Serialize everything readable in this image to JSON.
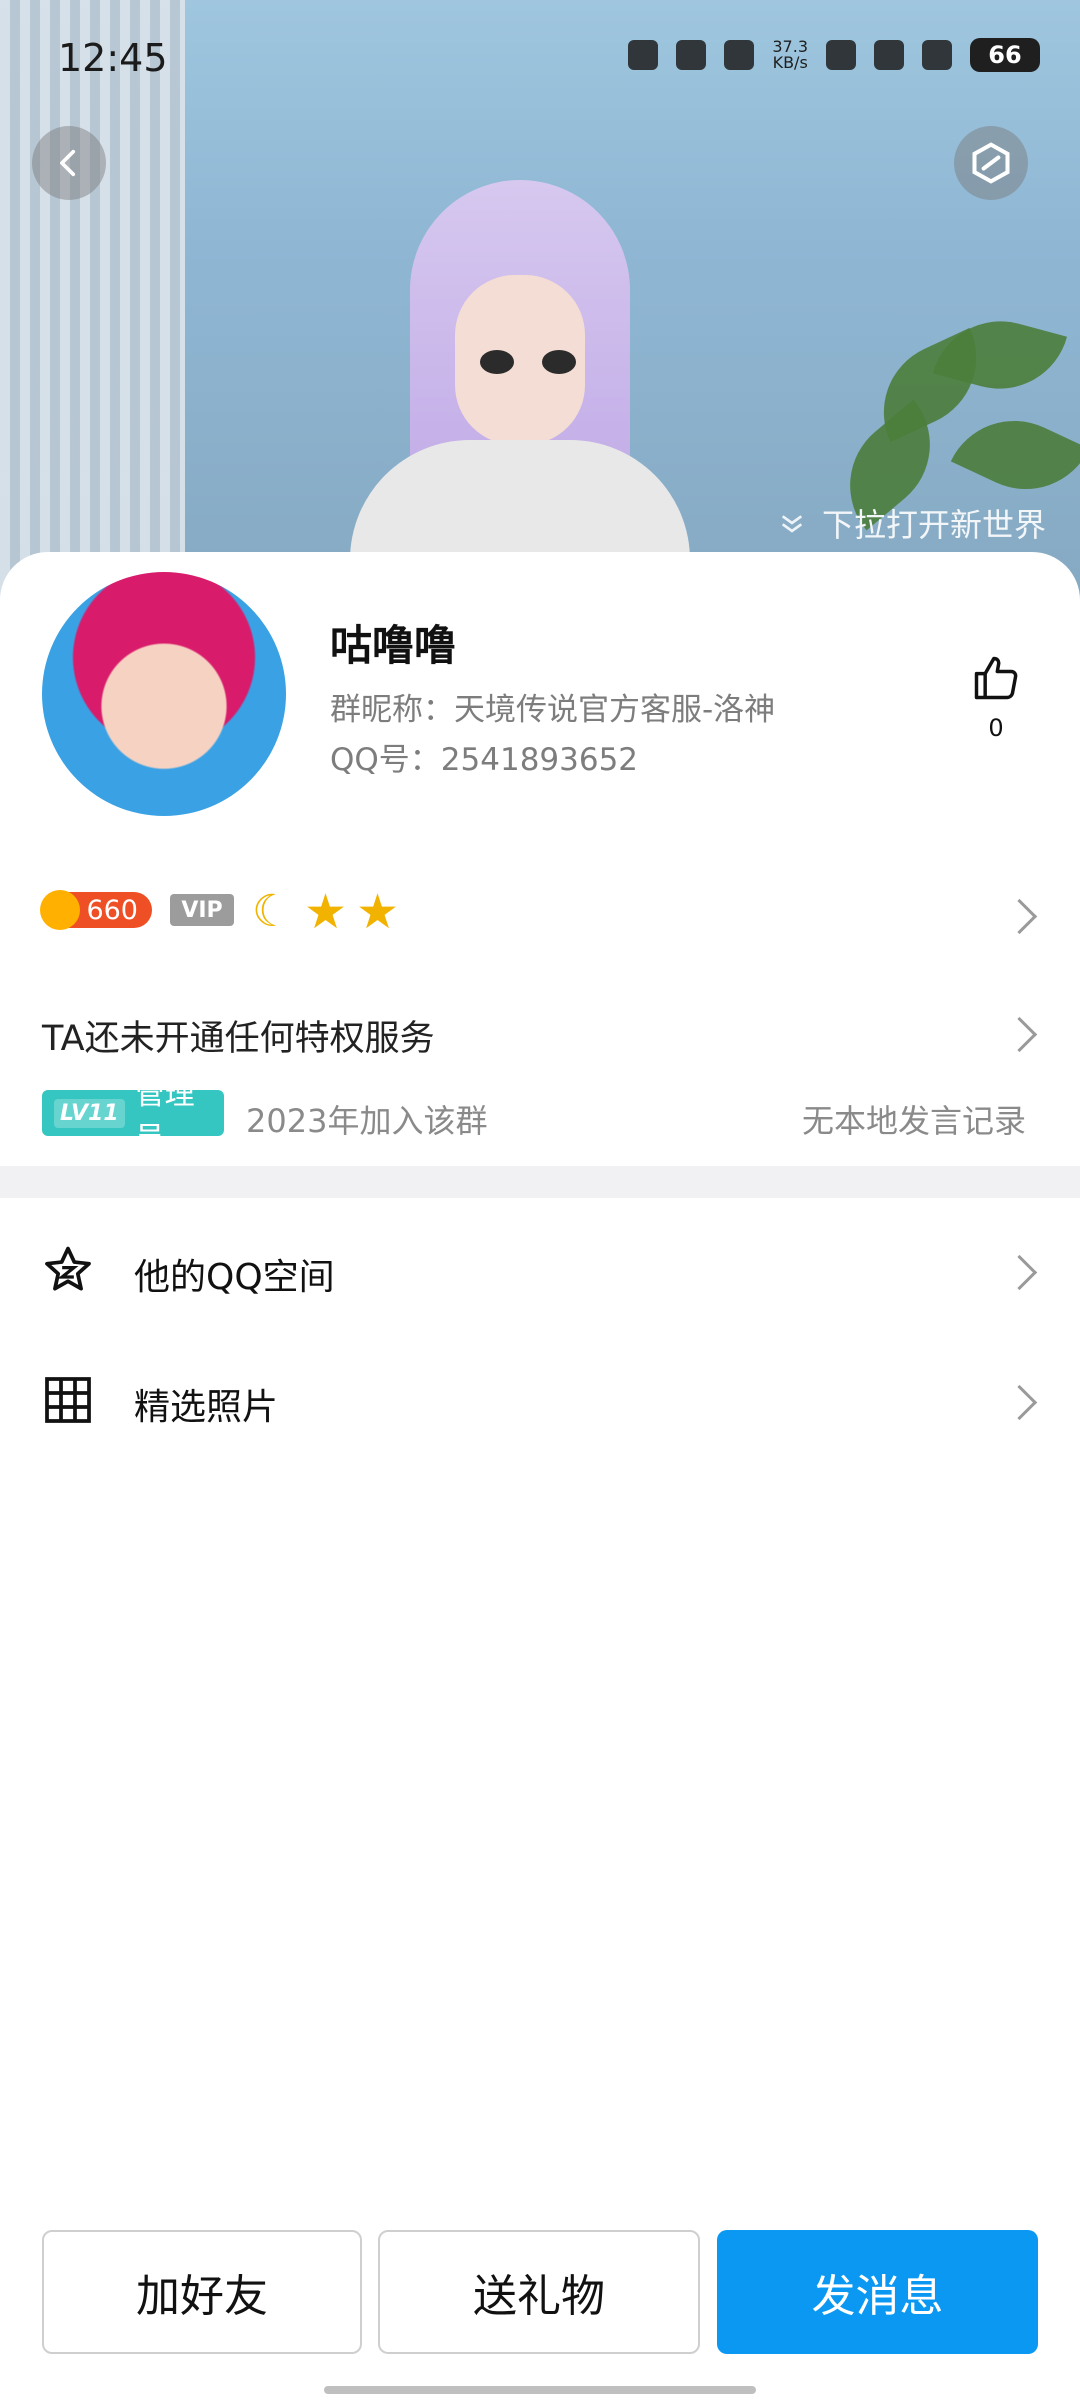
{
  "status_bar": {
    "time": "12:45",
    "network_speed": "37.3\nKB/s",
    "battery": "66"
  },
  "hero": {
    "pull_hint": "下拉打开新世界"
  },
  "profile": {
    "name": "咕噜噜",
    "group_nickname": "群昵称：天境传说官方客服-洛神",
    "qq_number": "QQ号：2541893652",
    "likes": "0"
  },
  "badges": {
    "coin_value": "660",
    "vip_label": "VIP"
  },
  "privilege": {
    "text": "TA还未开通任何特权服务"
  },
  "group_meta": {
    "level": "LV11",
    "role": "管理员",
    "joined": "2023年加入该群",
    "record": "无本地发言记录"
  },
  "menu": {
    "qzone_label": "他的QQ空间",
    "photos_label": "精选照片"
  },
  "actions": {
    "add_friend": "加好友",
    "send_gift": "送礼物",
    "send_message": "发消息"
  },
  "colors": {
    "primary_blue": "#0a98f3",
    "admin_badge": "#35c6c1",
    "coin_badge": "#ef4f24"
  }
}
